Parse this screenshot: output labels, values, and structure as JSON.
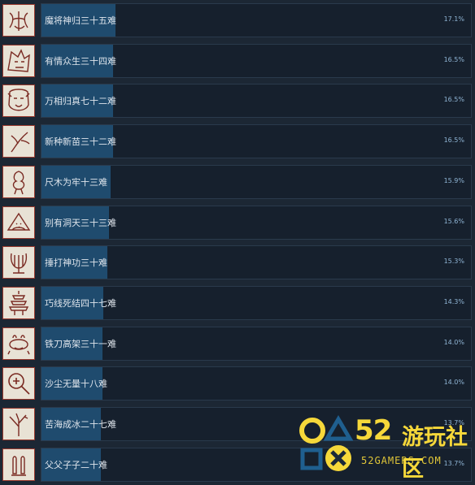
{
  "achievements": [
    {
      "name": "魔将神归三十五难",
      "percent": "17.1%",
      "value": 17.1,
      "icon": "demon-general-icon"
    },
    {
      "name": "有情众生三十四难",
      "percent": "16.5%",
      "value": 16.5,
      "icon": "beast-face-icon"
    },
    {
      "name": "万相归真七十二难",
      "percent": "16.5%",
      "value": 16.5,
      "icon": "monkey-king-icon"
    },
    {
      "name": "新种新苗三十二难",
      "percent": "16.5%",
      "value": 16.5,
      "icon": "sprout-icon"
    },
    {
      "name": "尺木为牢十三难",
      "percent": "15.9%",
      "value": 15.9,
      "icon": "tree-spirit-icon"
    },
    {
      "name": "别有洞天三十三难",
      "percent": "15.6%",
      "value": 15.6,
      "icon": "watermelon-slice-icon"
    },
    {
      "name": "捶打神功三十难",
      "percent": "15.3%",
      "value": 15.3,
      "icon": "lyre-icon"
    },
    {
      "name": "巧线死结四十七难",
      "percent": "14.3%",
      "value": 14.3,
      "icon": "pagoda-icon"
    },
    {
      "name": "铁刀高架三十一难",
      "percent": "14.0%",
      "value": 14.0,
      "icon": "frog-icon"
    },
    {
      "name": "沙尘无量十八难",
      "percent": "14.0%",
      "value": 14.0,
      "icon": "magnifier-icon"
    },
    {
      "name": "苦海成冰二十七难",
      "percent": "13.7%",
      "value": 13.7,
      "icon": "dead-tree-icon"
    },
    {
      "name": "父父子子二十难",
      "percent": "13.7%",
      "value": 13.7,
      "icon": "figures-icon"
    }
  ],
  "watermark": {
    "number": "52",
    "chinese": "游玩社区",
    "site": "52GAMERS.COM"
  },
  "colors": {
    "background": "#1b2838",
    "bar_fill": "#1f4b6e",
    "accent": "#f6d83a"
  }
}
